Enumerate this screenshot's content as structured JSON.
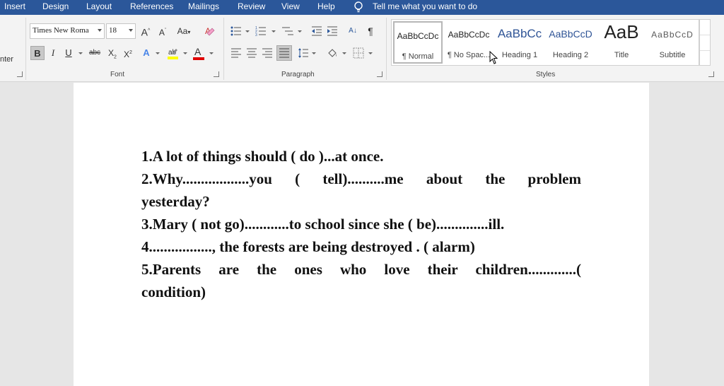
{
  "menu": {
    "tabs": [
      "Insert",
      "Design",
      "Layout",
      "References",
      "Mailings",
      "Review",
      "View",
      "Help"
    ],
    "tell_me": "Tell me what you want to do"
  },
  "ribbon": {
    "clipboard_partial_label": "nter",
    "font": {
      "name": "Times New Roma",
      "size": "18",
      "group_label": "Font",
      "bold": "B",
      "italic": "I",
      "underline": "U",
      "strike": "abc",
      "subscript": "X",
      "superscript": "X",
      "grow": "A",
      "shrink": "A",
      "change_case": "Aa",
      "font_color": "A",
      "text_effects": "A"
    },
    "paragraph": {
      "group_label": "Paragraph",
      "sort": "A↓",
      "pilcrow": "¶"
    },
    "styles": {
      "group_label": "Styles",
      "items": [
        {
          "preview": "AaBbCcDc",
          "name": "¶ Normal"
        },
        {
          "preview": "AaBbCcDc",
          "name": "¶ No Spac..."
        },
        {
          "preview": "AaBbCc",
          "name": "Heading 1"
        },
        {
          "preview": "AaBbCcD",
          "name": "Heading 2"
        },
        {
          "preview": "AaB",
          "name": "Title"
        },
        {
          "preview": "AaBbCcD",
          "name": "Subtitle"
        }
      ]
    }
  },
  "colors": {
    "menubar": "#2b579a",
    "highlight": "#ffff00",
    "font_color_bar": "#e00000",
    "heading_blue": "#2f5496"
  },
  "document": {
    "lines": [
      "1.A lot of things should ( do )...at once.",
      "2.Why..................you ( tell)..........me about the problem",
      "yesterday?",
      "3.Mary ( not go)............to school since she ( be)..............ill.",
      "4................., the forests are being destroyed . ( alarm)",
      "5.Parents are the ones who love their children.............(",
      "condition)"
    ]
  }
}
